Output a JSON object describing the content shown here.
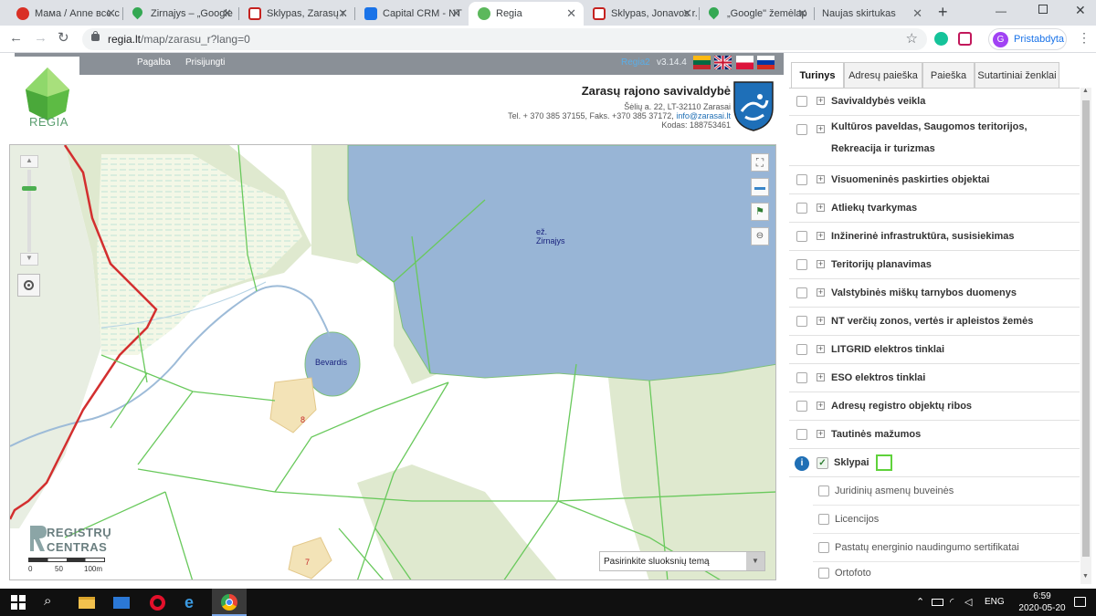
{
  "browser": {
    "tabs": [
      {
        "title": "Мама / Anne все с",
        "fav_color": "#d93025"
      },
      {
        "title": "Zirnajys – „Google",
        "fav_color": "#34a853"
      },
      {
        "title": "Sklypas, Zarasų r.",
        "fav_color": "#c5221f"
      },
      {
        "title": "Capital CRM - NT",
        "fav_color": "#1a73e8"
      },
      {
        "title": "Regia",
        "fav_color": "#5cb85c"
      },
      {
        "title": "Sklypas, Jonavos r.",
        "fav_color": "#c5221f"
      },
      {
        "title": "„Google\" žemėlap",
        "fav_color": "#34a853"
      },
      {
        "title": "Naujas skirtukas",
        "fav_color": ""
      }
    ],
    "new_tab_label": "+",
    "url_host": "regia.lt",
    "url_path": "/map/zarasu_r?lang=0",
    "profile_initial": "G",
    "profile_label": "Pristabdyta"
  },
  "site": {
    "nav_help": "Pagalba",
    "nav_login": "Prisijungti",
    "logo_text": "REGIA",
    "version_prefix": "Regia2",
    "version": "v3.14.4",
    "org_name": "Zarasų rajono savivaldybė",
    "address": "Šėlių a. 22, LT-32110 Zarasai",
    "phone_line": "Tel. + 370 385 37155, Faks. +370 385 37172,",
    "email": "info@zarasai.lt",
    "code_line": "Kodas: 188753461"
  },
  "map": {
    "lake_label_line1": "ež.",
    "lake_label_line2": "Zirnajys",
    "small_lake_label": "Bevardis",
    "parcel_label_1": "8",
    "parcel_label_2": "7",
    "registru_line1": "REGISTRŲ",
    "registru_line2": "CENTRAS",
    "scale_0": "0",
    "scale_50": "50",
    "scale_100": "100m",
    "theme_select": "Pasirinkite sluoksnių temą"
  },
  "panel": {
    "tabs": [
      "Turinys",
      "Adresų paieška",
      "Paieška",
      "Sutartiniai ženklai"
    ],
    "layers": [
      "Savivaldybės veikla",
      "Kultūros paveldas, Saugomos teritorijos, Rekreacija ir turizmas",
      "Visuomeninės paskirties objektai",
      "Atliekų tvarkymas",
      "Inžinerinė infrastruktūra, susisiekimas",
      "Teritorijų planavimas",
      "Valstybinės miškų tarnybos duomenys",
      "NT verčių zonos, vertės ir apleistos žemės",
      "LITGRID elektros tinklai",
      "ESO elektros tinklai",
      "Adresų registro objektų ribos",
      "Tautinės mažumos"
    ],
    "checked_layer": "Sklypai",
    "sub_layers": [
      "Juridinių asmenų buveinės",
      "Licencijos",
      "Pastatų energinio naudingumo sertifikatai",
      "Ortofoto"
    ]
  },
  "taskbar": {
    "lang": "ENG",
    "time": "6:59",
    "date": "2020-05-20"
  }
}
